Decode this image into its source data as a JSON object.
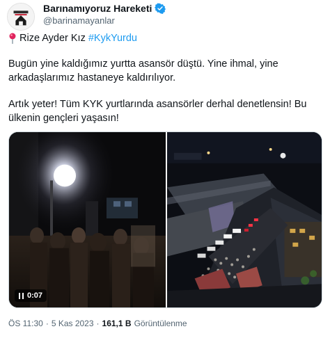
{
  "author": {
    "display_name": "Barınamıyoruz Hareketi",
    "handle": "@barinamayanlar",
    "avatar_icon": "avatar-logo",
    "verified_icon": "verified-badge-icon",
    "verified_color": "#1d9bf0"
  },
  "tweet": {
    "line1_prefix": "Rize Ayder Kız",
    "hashtag": "#KykYurdu",
    "pin_icon": "round-pushpin-icon",
    "paragraph1": "Bugün yine kaldığımız yurtta asansör düştü. Yine ihmal, yine arkadaşlarımız hastaneye kaldırılıyor.",
    "paragraph2": "Artık yeter! Tüm KYK yurtlarında asansörler derhal denetlensin! Bu ülkenin gençleri yaşasın!",
    "link_color": "#1d9bf0"
  },
  "media": {
    "video_duration": "0:07",
    "video_state_icon": "pause-icon"
  },
  "meta": {
    "time": "ÖS 11:30",
    "separator": "·",
    "date": "5 Kas 2023",
    "views_count": "161,1 B",
    "views_label": "Görüntülenme"
  }
}
